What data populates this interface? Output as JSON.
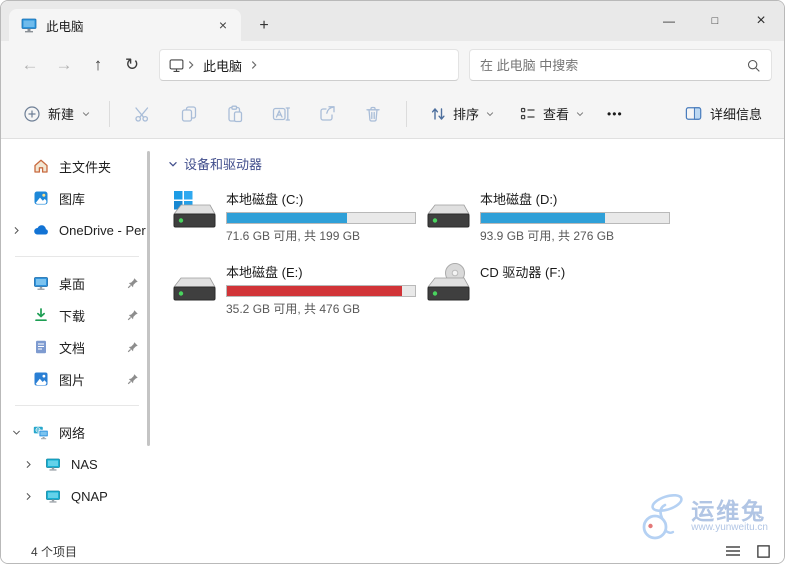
{
  "window": {
    "title": "此电脑"
  },
  "tab_bar": {
    "active_tab": "此电脑"
  },
  "nav": {
    "breadcrumb_root": "此电脑",
    "search_placeholder": "在 此电脑 中搜索"
  },
  "toolbar": {
    "new_label": "新建",
    "sort_label": "排序",
    "view_label": "查看",
    "more_label": "•••",
    "details_label": "详细信息"
  },
  "sidebar": {
    "items": [
      {
        "label": "主文件夹",
        "icon": "home-icon",
        "pinned": false
      },
      {
        "label": "图库",
        "icon": "gallery-icon",
        "pinned": false
      },
      {
        "label": "OneDrive - Per",
        "icon": "onedrive-icon",
        "pinned": false,
        "chevron": "collapsed"
      },
      {
        "label": "桌面",
        "icon": "desktop-icon",
        "pinned": true
      },
      {
        "label": "下载",
        "icon": "downloads-icon",
        "pinned": true
      },
      {
        "label": "文档",
        "icon": "documents-icon",
        "pinned": true
      },
      {
        "label": "图片",
        "icon": "pictures-icon",
        "pinned": true
      },
      {
        "label": "网络",
        "icon": "network-icon",
        "pinned": false,
        "chevron": "expanded"
      },
      {
        "label": "NAS",
        "icon": "computer-icon",
        "pinned": false,
        "chevron": "collapsed"
      },
      {
        "label": "QNAP",
        "icon": "computer-icon",
        "pinned": false,
        "chevron": "collapsed"
      }
    ]
  },
  "main": {
    "section_title": "设备和驱动器",
    "drives": [
      {
        "name": "本地磁盘 (C:)",
        "caption": "71.6 GB 可用, 共 199 GB",
        "used_percent": 64,
        "bar_color": "#2fa0d8",
        "kind": "system-disk"
      },
      {
        "name": "本地磁盘 (D:)",
        "caption": "93.9 GB 可用, 共 276 GB",
        "used_percent": 66,
        "bar_color": "#2fa0d8",
        "kind": "local-disk"
      },
      {
        "name": "本地磁盘 (E:)",
        "caption": "35.2 GB 可用, 共 476 GB",
        "used_percent": 93,
        "bar_color": "#d13438",
        "kind": "local-disk"
      },
      {
        "name": "CD 驱动器 (F:)",
        "caption": "",
        "used_percent": null,
        "bar_color": null,
        "kind": "cd-drive"
      }
    ]
  },
  "statusbar": {
    "item_count": "4 个项目"
  },
  "watermark": {
    "brand": "运维兔",
    "url": "www.yunweitu.cn"
  },
  "glyphs": {
    "minimize": "—",
    "maximize": "□",
    "close": "×",
    "new_tab": "+",
    "tab_close": "×",
    "back": "←",
    "forward": "→",
    "up": "↑",
    "refresh": "↻",
    "more": "•••"
  },
  "colors": {
    "accent_blue": "#2fa0d8",
    "warning_red": "#d13438",
    "chrome": "#f5f5f5",
    "titlebar": "#e9e9e9"
  }
}
